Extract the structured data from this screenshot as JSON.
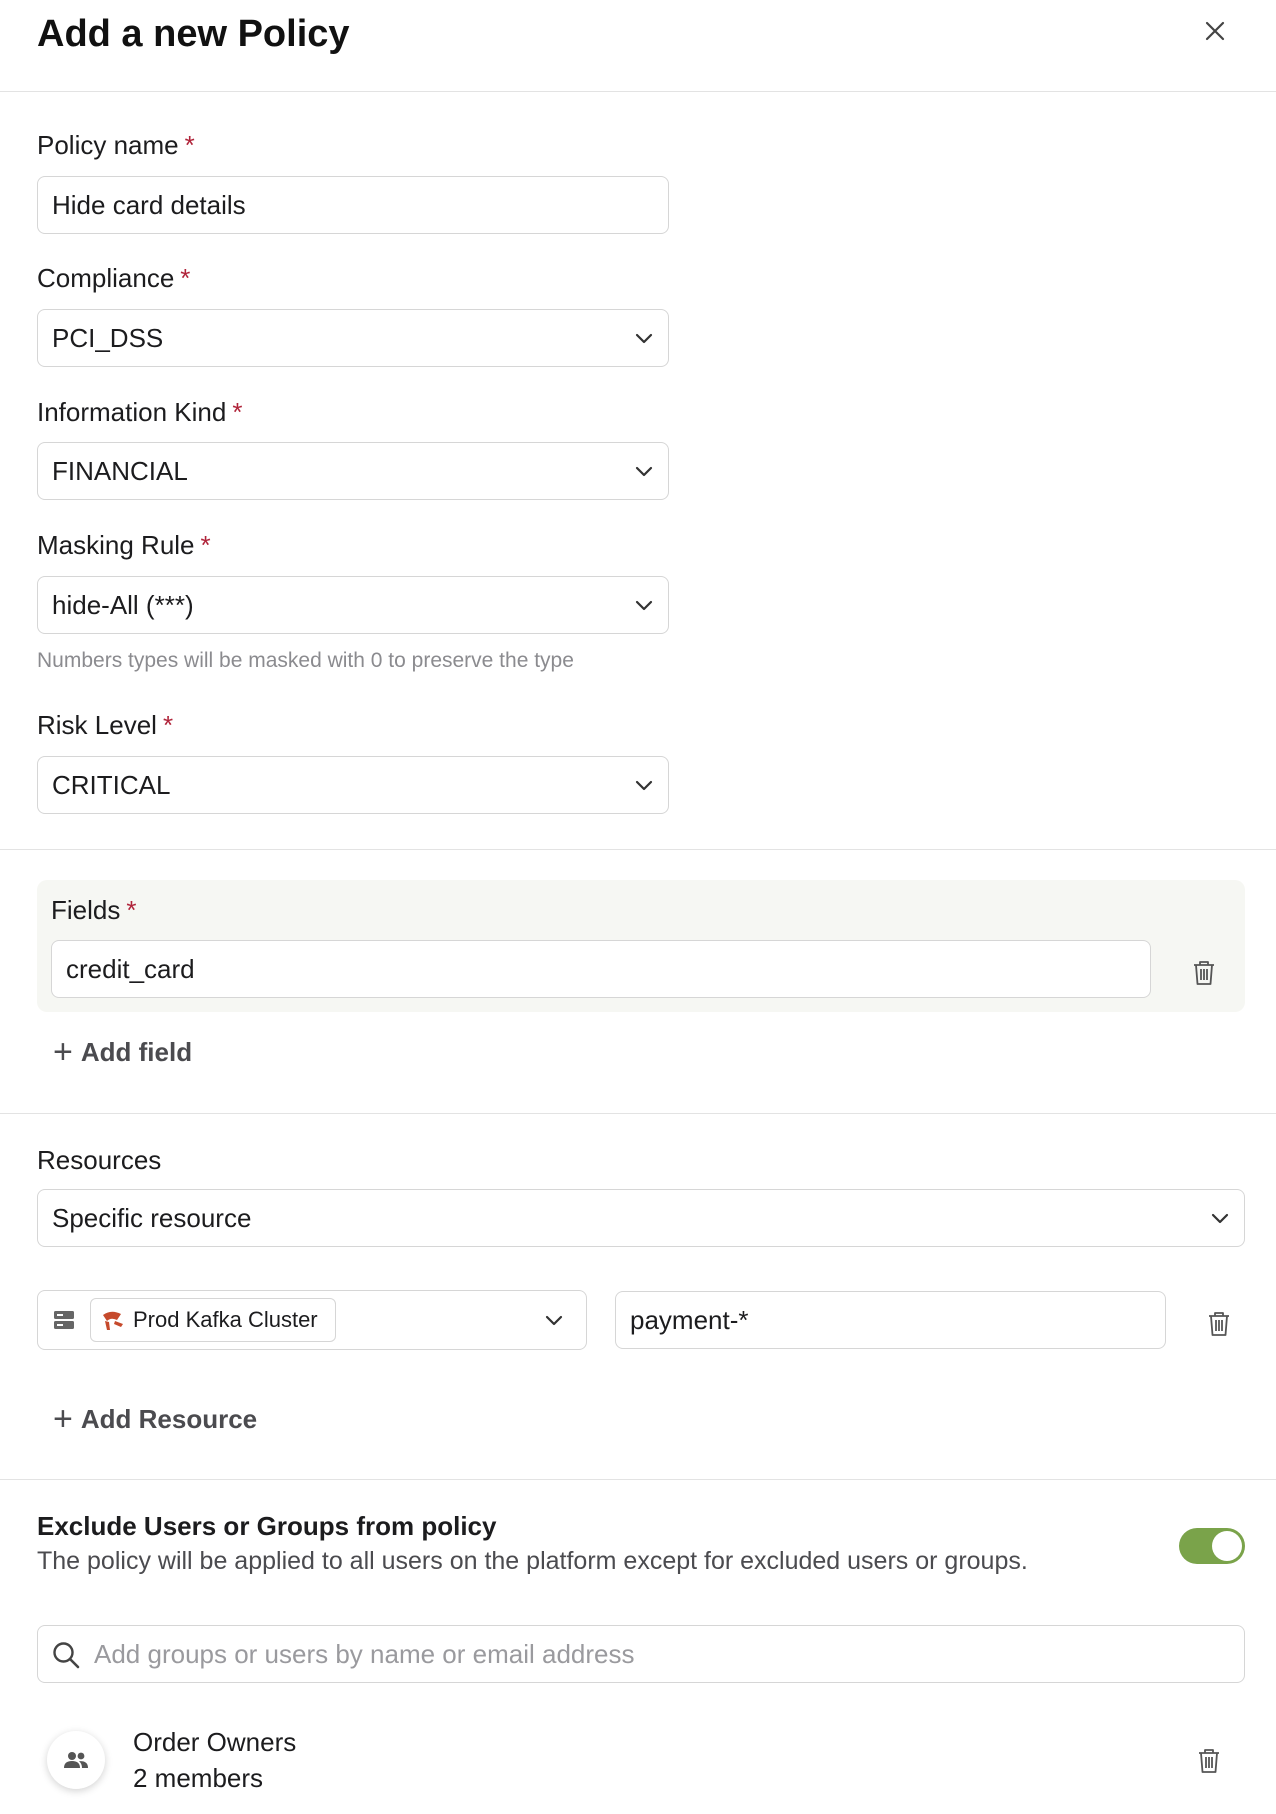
{
  "dialog": {
    "title": "Add a new Policy",
    "close_icon": "close-icon"
  },
  "form": {
    "required_marker": "*",
    "policy_name": {
      "label": "Policy name",
      "value": "Hide card details"
    },
    "compliance": {
      "label": "Compliance",
      "value": "PCI_DSS"
    },
    "information_kind": {
      "label": "Information Kind",
      "value": "FINANCIAL"
    },
    "masking_rule": {
      "label": "Masking Rule",
      "value": "hide-All (***)",
      "hint": "Numbers types will be masked with 0 to preserve the type"
    },
    "risk_level": {
      "label": "Risk Level",
      "value": "CRITICAL"
    }
  },
  "fields": {
    "label": "Fields",
    "items": [
      "credit_card"
    ],
    "add_label": "Add field"
  },
  "resources": {
    "label": "Resources",
    "scope": "Specific resource",
    "items": [
      {
        "cluster": "Prod Kafka Cluster",
        "pattern": "payment-*"
      }
    ],
    "add_label": "Add Resource"
  },
  "exclusions": {
    "title": "Exclude Users or Groups from policy",
    "description": "The policy will be applied to all users on the platform except for excluded users or groups.",
    "enabled": true,
    "search_placeholder": "Add groups or users by name or email address",
    "groups": [
      {
        "name": "Order Owners",
        "members": "2 members"
      }
    ]
  },
  "colors": {
    "required": "#b0243a",
    "toggle_on": "#7aa34a",
    "fields_bg": "#f6f7f3",
    "kafka": "#c64a2c"
  }
}
